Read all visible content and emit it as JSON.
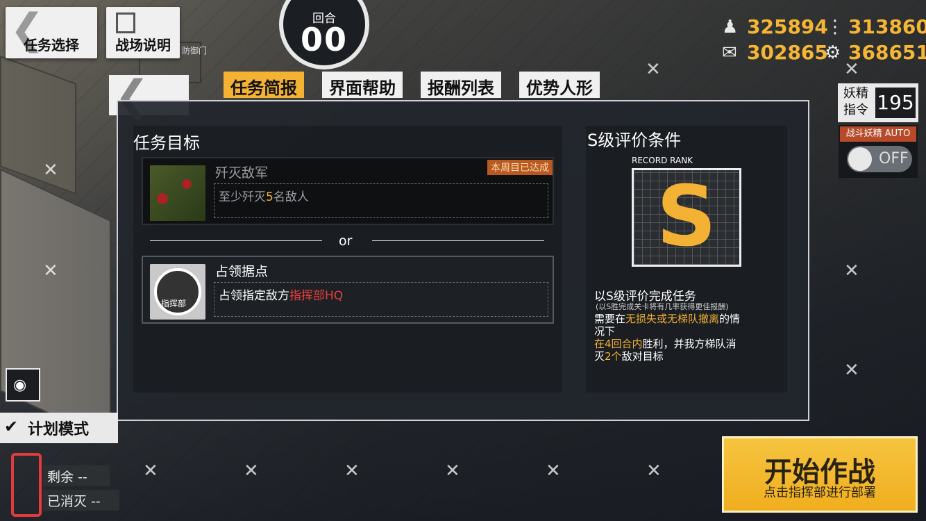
{
  "header": {
    "task_select": "任务选择",
    "battle_info": "战场说明",
    "map_label": "防御门",
    "turn_label": "回合",
    "turn_value": "00"
  },
  "resources": {
    "manpower": "325894",
    "ammo": "313860",
    "rations": "302865",
    "parts": "368651"
  },
  "tabs": [
    "任务简报",
    "界面帮助",
    "报酬列表",
    "优势人形"
  ],
  "fairy": {
    "label_line1": "妖精",
    "label_line2": "指令",
    "value": "195",
    "auto_label": "战斗妖精 AUTO",
    "toggle_state": "OFF"
  },
  "objectives": {
    "title": "任务目标",
    "primary": {
      "name": "歼灭敌军",
      "desc_prefix": "至少歼灭",
      "desc_count": "5",
      "desc_suffix": "名敌人",
      "badge": "本周目已达成"
    },
    "separator": "or",
    "secondary": {
      "name": "占领据点",
      "desc_prefix": "占领指定敌方",
      "desc_target": "指挥部HQ",
      "thumb_label": "指挥部"
    }
  },
  "rank": {
    "title": "S级评价条件",
    "record_label": "RECORD RANK",
    "letter": "S",
    "heading": "以S级评价完成任务",
    "note": "(以S胜完成关卡将有几率获得更佳报酬)",
    "line1_prefix": "需要在",
    "line1_highlight": "无损失或无梯队撤离",
    "line1_suffix": "的情",
    "line2": "况下",
    "line3_highlight": "在4回合内",
    "line3_suffix": "胜利，并我方梯队消",
    "line4_prefix": "灭",
    "line4_highlight": "2个",
    "line4_suffix": "敌对目标"
  },
  "bottom_left": {
    "plan_mode": "计划模式",
    "remaining_label": "剩余",
    "remaining_value": "--",
    "destroyed_label": "已消灭",
    "destroyed_value": "--"
  },
  "start_button": {
    "label": "开始作战",
    "sub": "点击指挥部进行部署"
  },
  "colors": {
    "accent": "#f3b233",
    "highlight_red": "#e8403a",
    "done_badge": "#b85a1e"
  }
}
